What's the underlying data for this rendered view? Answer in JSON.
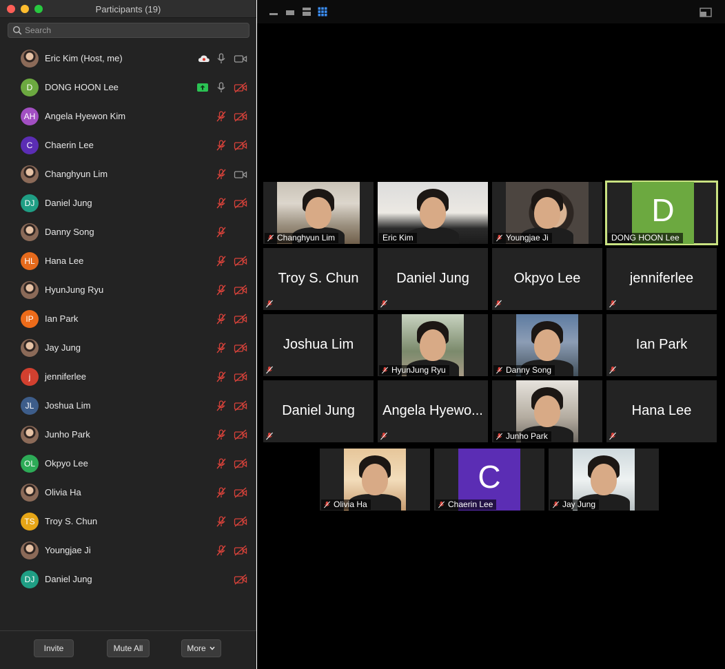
{
  "window": {
    "title": "Participants (19)"
  },
  "search": {
    "placeholder": "Search"
  },
  "colors": {
    "accent_active_border": "#c9e281",
    "muted_red": "#d8423a",
    "share_green": "#2bc253"
  },
  "participants": [
    {
      "name": "Eric Kim (Host, me)",
      "avatar": "photo",
      "mic": "on",
      "video": "on",
      "status": "cloud-recording-icon"
    },
    {
      "name": "DONG HOON Lee",
      "initials": "D",
      "color": "#6ca940",
      "mic": "on",
      "video": "off",
      "status": "share-screen-icon"
    },
    {
      "name": "Angela Hyewon Kim",
      "initials": "AH",
      "color": "#a24fc2",
      "mic": "muted",
      "video": "off"
    },
    {
      "name": "Chaerin Lee",
      "initials": "C",
      "color": "#5b2db4",
      "mic": "muted",
      "video": "off"
    },
    {
      "name": "Changhyun Lim",
      "avatar": "photo",
      "mic": "muted",
      "video": "on"
    },
    {
      "name": "Daniel Jung",
      "initials": "DJ",
      "color": "#1f9e84",
      "mic": "muted",
      "video": "off"
    },
    {
      "name": "Danny Song",
      "avatar": "photo",
      "mic": "muted",
      "video": "none"
    },
    {
      "name": "Hana Lee",
      "initials": "HL",
      "color": "#e56a1c",
      "mic": "muted",
      "video": "off"
    },
    {
      "name": "HyunJung Ryu",
      "avatar": "photo",
      "mic": "muted",
      "video": "off"
    },
    {
      "name": "Ian Park",
      "initials": "IP",
      "color": "#ec6b1a",
      "mic": "muted",
      "video": "off"
    },
    {
      "name": "Jay Jung",
      "avatar": "photo",
      "mic": "muted",
      "video": "off"
    },
    {
      "name": "jenniferlee",
      "initials": "j",
      "color": "#d2402f",
      "mic": "muted",
      "video": "off"
    },
    {
      "name": "Joshua Lim",
      "initials": "JL",
      "color": "#3d5d8a",
      "mic": "muted",
      "video": "off"
    },
    {
      "name": "Junho Park",
      "avatar": "photo",
      "mic": "muted",
      "video": "off"
    },
    {
      "name": "Okpyo Lee",
      "initials": "OL",
      "color": "#2dab57",
      "mic": "muted",
      "video": "off"
    },
    {
      "name": "Olivia Ha",
      "avatar": "photo",
      "mic": "muted",
      "video": "off"
    },
    {
      "name": "Troy S. Chun",
      "initials": "TS",
      "color": "#e6a516",
      "mic": "muted",
      "video": "off"
    },
    {
      "name": "Youngjae Ji",
      "avatar": "photo",
      "mic": "muted",
      "video": "off"
    },
    {
      "name": "Daniel Jung",
      "initials": "DJ",
      "color": "#1f9e84",
      "mic": "none",
      "video": "off"
    }
  ],
  "footer": {
    "invite": "Invite",
    "mute_all": "Mute All",
    "more": "More"
  },
  "gallery": {
    "tiles": [
      {
        "name": "Changhyun Lim",
        "type": "video",
        "scene": "v-hostroom",
        "label_muted": true
      },
      {
        "name": "Eric Kim",
        "type": "video",
        "scene": "v-office",
        "label_muted": false
      },
      {
        "name": "Youngjae Ji",
        "type": "video",
        "scene": "v-dark",
        "label_muted": true
      },
      {
        "name": "DONG HOON Lee",
        "type": "letter",
        "letter": "D",
        "scene": "v-green",
        "active": true
      },
      {
        "name": "Troy S. Chun",
        "type": "name"
      },
      {
        "name": "Daniel Jung",
        "type": "name"
      },
      {
        "name": "Okpyo Lee",
        "type": "name"
      },
      {
        "name": "jenniferlee",
        "type": "name"
      },
      {
        "name": "Joshua Lim",
        "type": "name"
      },
      {
        "name": "HyunJung Ryu",
        "type": "video",
        "scene": "v-outdoor",
        "label_muted": true
      },
      {
        "name": "Danny Song",
        "type": "video",
        "scene": "v-lake",
        "label_muted": true
      },
      {
        "name": "Ian Park",
        "type": "name"
      },
      {
        "name": "Daniel Jung",
        "type": "name"
      },
      {
        "name": "Angela Hyewo...",
        "type": "name"
      },
      {
        "name": "Junho Park",
        "type": "video",
        "scene": "v-street",
        "label_muted": true
      },
      {
        "name": "Hana Lee",
        "type": "name"
      },
      {
        "name": "Olivia Ha",
        "type": "video",
        "scene": "v-warm",
        "label_muted": true
      },
      {
        "name": "Chaerin Lee",
        "type": "letter",
        "letter": "C",
        "scene": "v-purple",
        "label_muted": true
      },
      {
        "name": "Jay Jung",
        "type": "video",
        "scene": "v-bright",
        "label_muted": true
      }
    ]
  }
}
